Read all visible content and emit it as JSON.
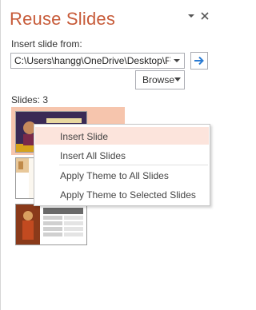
{
  "pane": {
    "title": "Reuse Slides",
    "insert_from_label": "Insert slide from:",
    "path_value": "C:\\Users\\hangg\\OneDrive\\Desktop\\F",
    "browse_label": "Browse",
    "slides_label": "Slides: 3"
  },
  "context_menu": {
    "items": [
      {
        "label": "Insert Slide"
      },
      {
        "label": "Insert All Slides"
      },
      {
        "label": "Apply Theme to All Slides"
      },
      {
        "label": "Apply Theme to Selected Slides"
      }
    ]
  },
  "colors": {
    "accent": "#c75b39",
    "selection": "#f6c5ad",
    "menu_hover": "#fce4dc",
    "arrow": "#2b7cd3"
  },
  "icons": {
    "collapse": "chevron-down-icon",
    "close": "close-icon",
    "go": "arrow-right-icon",
    "dropdown": "caret-down-icon"
  }
}
